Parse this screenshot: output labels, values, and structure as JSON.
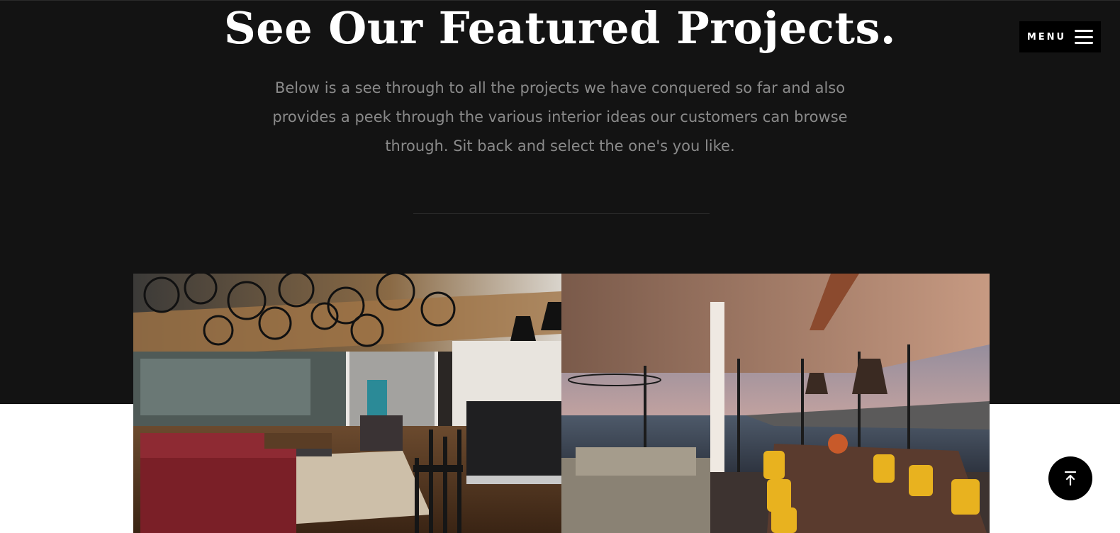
{
  "hero": {
    "title": "See Our Featured Projects.",
    "description": "Below is a see through to all the projects we have conquered so far and also provides a peek through the various interior ideas our customers can browse through. Sit back and select the one's you like."
  },
  "nav": {
    "menu_label": "MENU",
    "menu_icon": "hamburger-icon"
  },
  "projects": [
    {
      "image": "office-lounge-with-bicycle-ceiling"
    },
    {
      "image": "ocean-view-dining-room"
    }
  ],
  "back_to_top": {
    "icon": "arrow-up-to-line-icon"
  },
  "colors": {
    "band": "#131313",
    "title": "#ffffff",
    "body_text": "#8a8a8a",
    "button": "#000000"
  }
}
